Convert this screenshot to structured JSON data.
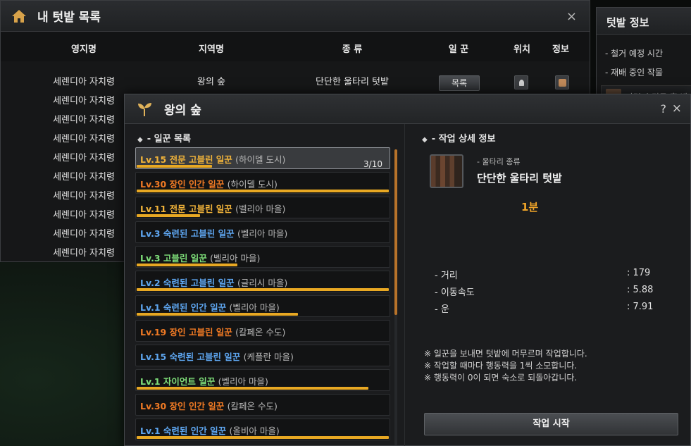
{
  "fields_window": {
    "title": "내 텃밭 목록",
    "close": "×",
    "columns": {
      "territory": "영지명",
      "region": "지역명",
      "type": "종 류",
      "worker": "일 꾼",
      "position": "위치",
      "info": "정보"
    },
    "rows": [
      {
        "territory": "세렌디아 자치령",
        "region": "왕의 숲",
        "type": "단단한 울타리 텃밭",
        "worker_button": "목록"
      },
      {
        "territory": "세렌디아 자치령"
      },
      {
        "territory": "세렌디아 자치령"
      },
      {
        "territory": "세렌디아 자치령"
      },
      {
        "territory": "세렌디아 자치령"
      },
      {
        "territory": "세렌디아 자치령"
      },
      {
        "territory": "세렌디아 자치령"
      },
      {
        "territory": "세렌디아 자치령"
      },
      {
        "territory": "세렌디아 자치령"
      },
      {
        "territory": "세렌디아 자치령"
      }
    ]
  },
  "field_info_window": {
    "title": "텃밭 정보",
    "items": [
      "- 철거 예정 시간",
      "- 재배 중인 작물"
    ],
    "crop_label": "마력이 깃든 흙 밭"
  },
  "forest_window": {
    "title": "왕의 숲",
    "help": "?",
    "close": "×",
    "worker_list_title": "- 일꾼 목록",
    "detail_title": "- 작업 상세 정보",
    "workers": [
      {
        "name": "Lv.15 전문 고블린 일꾼",
        "town": "(하이델 도시)",
        "color": "#f2b43a",
        "progress": 0.3,
        "count": "3/10",
        "selected": true
      },
      {
        "name": "Lv.30 장인 인간 일꾼",
        "town": "(하이델 도시)",
        "color": "#f07a24",
        "progress": 1.0
      },
      {
        "name": "Lv.11 전문 고블린 일꾼",
        "town": "(벨리아 마을)",
        "color": "#f2b43a",
        "progress": 0.25
      },
      {
        "name": "Lv.3 숙련된 고블린 일꾼",
        "town": "(벨리아 마을)",
        "color": "#5ea6f0",
        "progress": 0.0
      },
      {
        "name": "Lv.3 고블린 일꾼",
        "town": "(벨리아 마을)",
        "color": "#7fe07a",
        "progress": 0.4
      },
      {
        "name": "Lv.2 숙련된 고블린 일꾼",
        "town": "(글리시 마을)",
        "color": "#5ea6f0",
        "progress": 1.0
      },
      {
        "name": "Lv.1 숙련된 인간 일꾼",
        "town": "(벨리아 마을)",
        "color": "#5ea6f0",
        "progress": 0.64
      },
      {
        "name": "Lv.19 장인 고블린 일꾼",
        "town": "(칼페온 수도)",
        "color": "#f07a24",
        "progress": 0.0
      },
      {
        "name": "Lv.15 숙련된 고블린 일꾼",
        "town": "(케플란 마을)",
        "color": "#5ea6f0",
        "progress": 0.0
      },
      {
        "name": "Lv.1 자이언트 일꾼",
        "town": "(벨리아 마을)",
        "color": "#7fe07a",
        "progress": 0.92
      },
      {
        "name": "Lv.30 장인 인간 일꾼",
        "town": "(칼페온 수도)",
        "color": "#f07a24",
        "progress": 0.0
      },
      {
        "name": "Lv.1 숙련된 인간 일꾼",
        "town": "(올비아 마을)",
        "color": "#5ea6f0",
        "progress": 1.0
      }
    ],
    "detail": {
      "crop_type_label": "- 울타리 종류",
      "crop_name": "단단한 울타리 텃밭",
      "duration": "1분",
      "stats": [
        {
          "label": "- 거리",
          "value": ": 179"
        },
        {
          "label": "- 이동속도",
          "value": ": 5.88"
        },
        {
          "label": "- 운",
          "value": ": 7.91"
        }
      ],
      "notes": [
        "※ 일꾼을 보내면 텃밭에 머무르며 작업합니다.",
        "※ 작업할 때마다 행동력을 1씩 소모합니다.",
        "※ 행동력이 0이 되면 숙소로 되돌아갑니다."
      ],
      "start_button": "작업 시작"
    },
    "scroll_position": 0.0
  }
}
